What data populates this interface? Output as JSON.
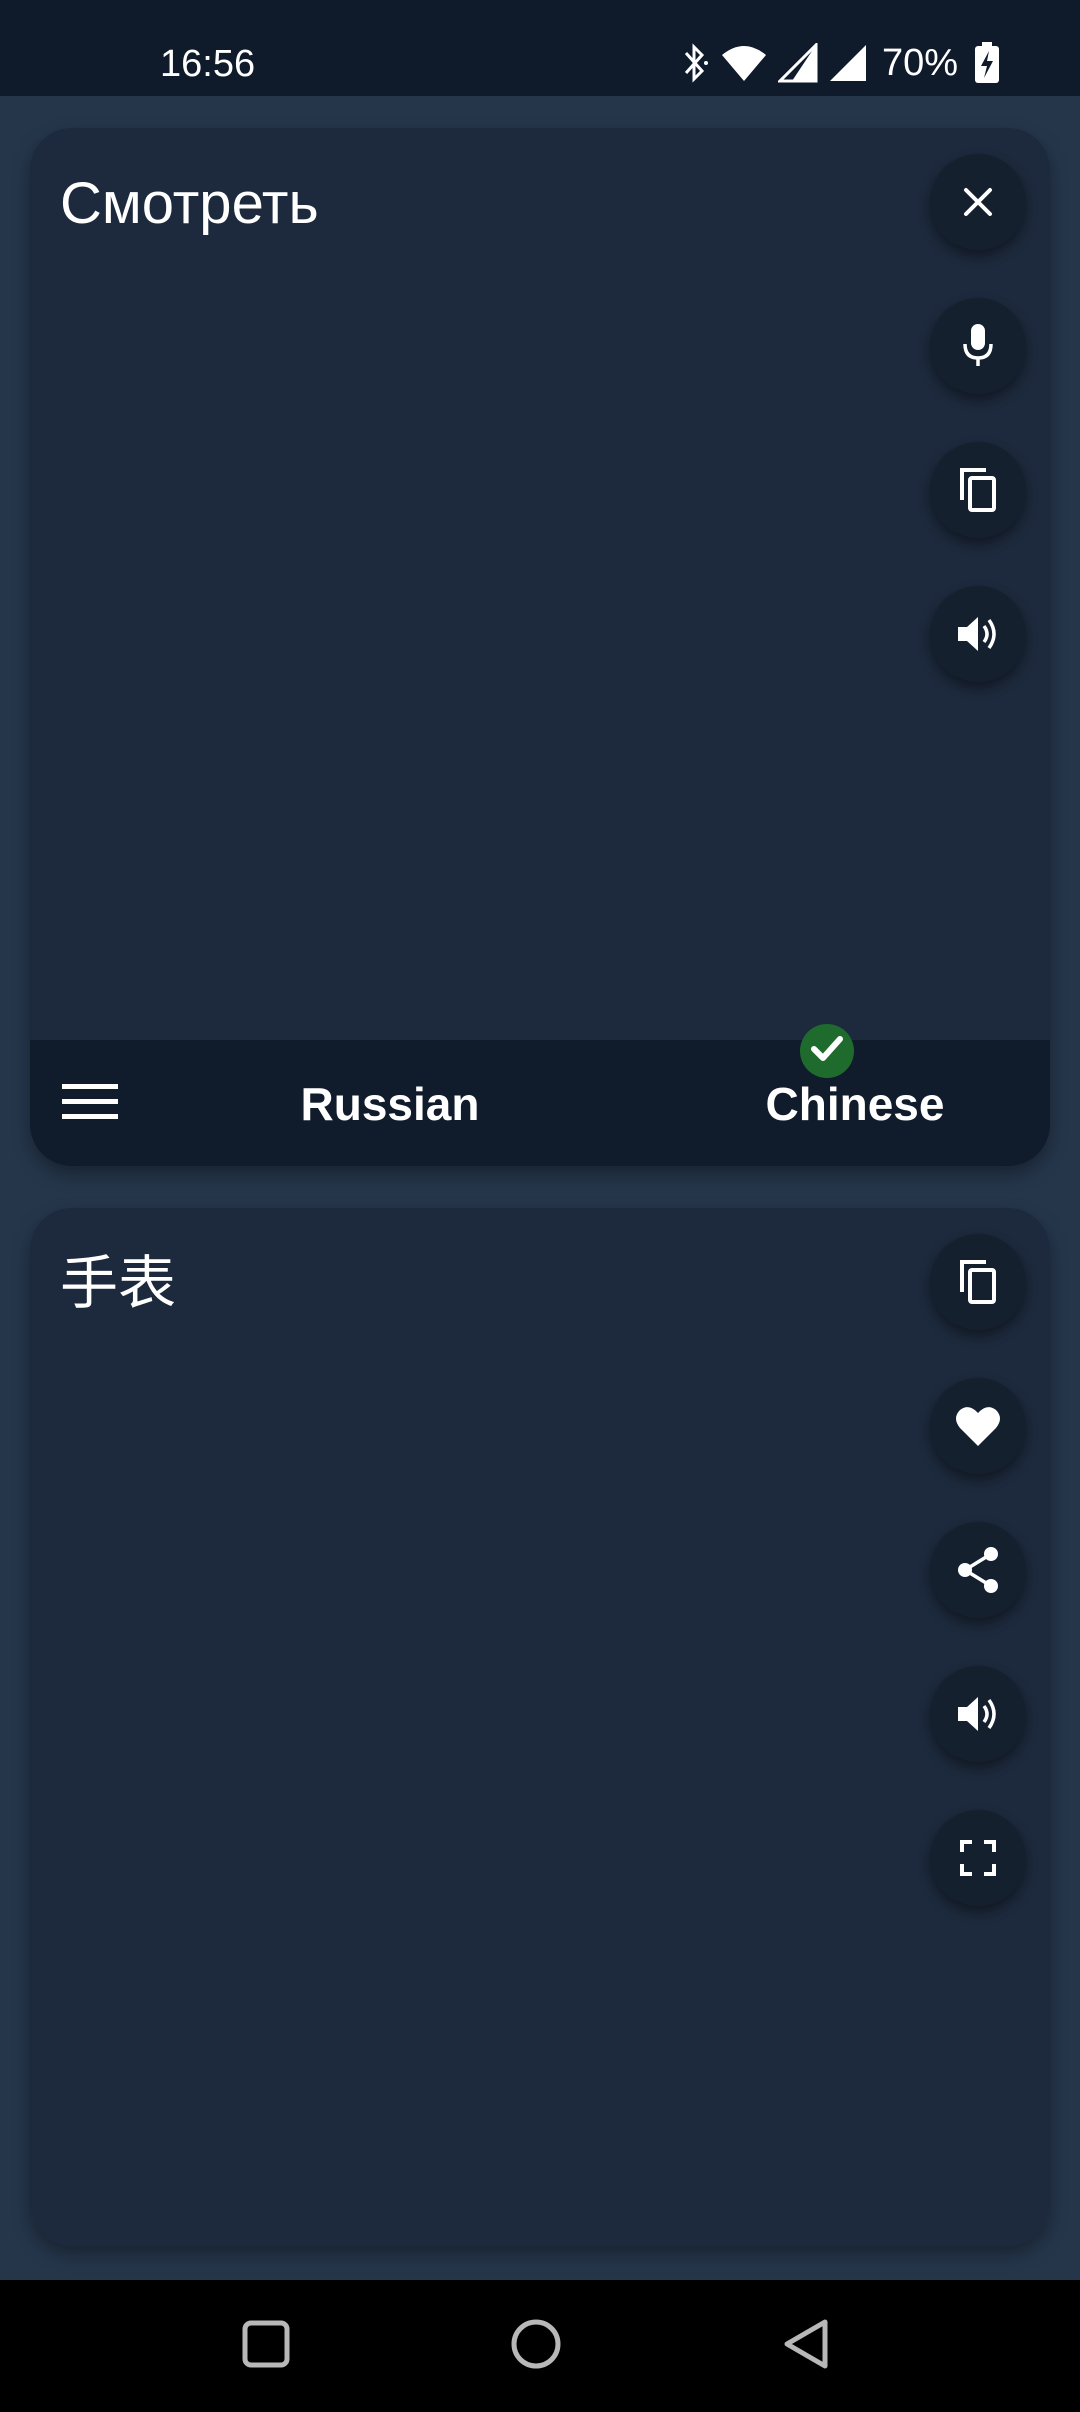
{
  "status_bar": {
    "time": "16:56",
    "battery_percent": "70%",
    "icons": [
      "bluetooth-icon",
      "wifi-icon",
      "signal-icon",
      "signal-icon",
      "battery-charging-icon"
    ]
  },
  "source_panel": {
    "text": "Смотреть",
    "actions": [
      "close-icon",
      "microphone-icon",
      "copy-icon",
      "speaker-icon"
    ]
  },
  "language_bar": {
    "source_language": "Russian",
    "target_language": "Chinese",
    "menu_icon": "menu-icon",
    "selected_indicator": "check-icon"
  },
  "target_panel": {
    "text": "手表",
    "actions": [
      "copy-icon",
      "heart-icon",
      "share-icon",
      "speaker-icon",
      "fullscreen-icon"
    ]
  },
  "nav_bar": {
    "buttons": [
      "recent-apps-icon",
      "home-icon",
      "back-icon"
    ]
  },
  "colors": {
    "background": "#25364b",
    "card": "#1d2a3d",
    "fab": "#15202f",
    "lang_bar": "#101b2b",
    "check": "#1f6b2e"
  }
}
